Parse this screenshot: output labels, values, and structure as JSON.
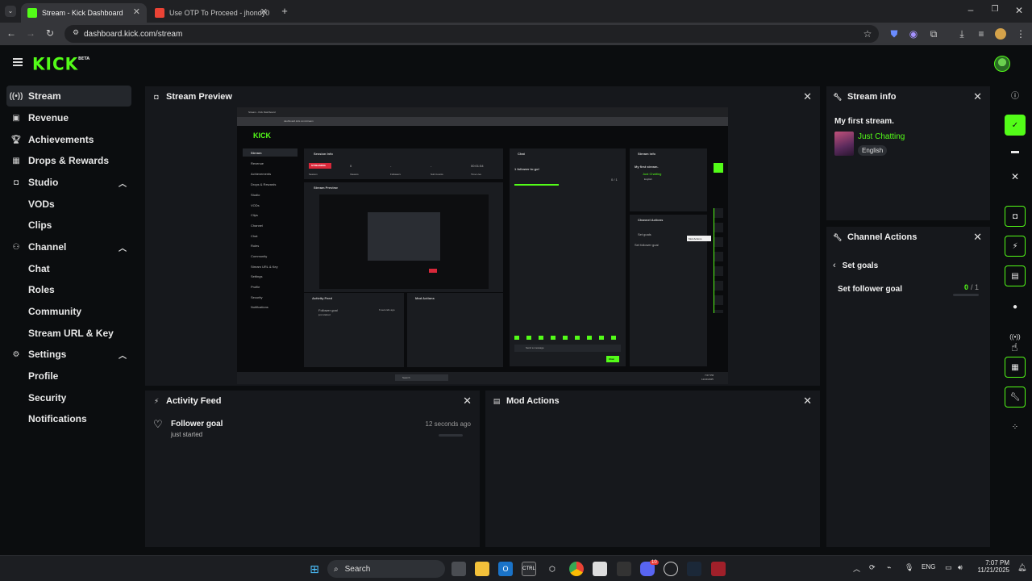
{
  "browser": {
    "tabs": [
      {
        "title": "Stream - Kick Dashboard",
        "active": true
      },
      {
        "title": "Use OTP To Proceed - jhondy0"
      }
    ],
    "url": "dashboard.kick.com/stream"
  },
  "header": {
    "logo": "KICK",
    "logo_badge": "BETA"
  },
  "sidebar": {
    "items": [
      {
        "label": "Stream",
        "icon": "broadcast-icon"
      },
      {
        "label": "Revenue",
        "icon": "wallet-icon"
      },
      {
        "label": "Achievements",
        "icon": "trophy-icon"
      },
      {
        "label": "Drops & Rewards",
        "icon": "gift-icon"
      },
      {
        "label": "Studio",
        "icon": "camera-icon"
      },
      {
        "label": "VODs"
      },
      {
        "label": "Clips"
      },
      {
        "label": "Channel",
        "icon": "users-icon"
      },
      {
        "label": "Chat"
      },
      {
        "label": "Roles"
      },
      {
        "label": "Community"
      },
      {
        "label": "Stream URL & Key"
      },
      {
        "label": "Settings",
        "icon": "gear-icon"
      },
      {
        "label": "Profile"
      },
      {
        "label": "Security"
      },
      {
        "label": "Notifications"
      }
    ]
  },
  "stream_preview": {
    "title": "Stream Preview",
    "mini": {
      "session_info": "Session Info",
      "streaming": "STREAMING",
      "session": "Session",
      "viewers": "Viewers",
      "followers": "Followers",
      "sub_counts": "Sub Counts",
      "time_live": "Time Live",
      "viewers_val": "0",
      "followers_val": "-",
      "subs_val": "-",
      "time_val": "00:01:54",
      "chat": "Chat",
      "follower_goal": "1 follower to go!",
      "goal_count": "0 / 1",
      "stream_info": "Stream info",
      "first_stream": "My first stream.",
      "just_chatting": "Just Chatting",
      "english": "English",
      "channel_actions": "Channel Actions",
      "set_goals": "Set goals",
      "set_follower_goal": "Set follower goal",
      "mod_actions_tip": "Mod Actions",
      "activity_feed": "Activity Feed",
      "follower_goal_item": "Follower goal",
      "just_started": "just started",
      "seconds_ago": "6 seconds ago",
      "mod_actions": "Mod Actions",
      "send_message": "Send a message",
      "chat_btn": "Chat",
      "search": "Search",
      "time": "7:07 PM",
      "date": "11/21/2025"
    }
  },
  "stream_info": {
    "title": "Stream info",
    "stream_title": "My first stream.",
    "category": "Just Chatting",
    "tag": "English"
  },
  "channel_actions": {
    "title": "Channel Actions",
    "back_label": "Set goals",
    "goal_label": "Set follower goal",
    "goal_current": "0",
    "goal_total": "/ 1",
    "goal_progress": 0
  },
  "activity_feed": {
    "title": "Activity Feed",
    "items": [
      {
        "title": "Follower goal",
        "subtitle": "just started",
        "time": "12 seconds ago"
      }
    ]
  },
  "mod_actions": {
    "title": "Mod Actions"
  },
  "taskbar": {
    "search": "Search",
    "lang": "ENG",
    "time": "7:07 PM",
    "date": "11/21/2025",
    "badge": "10"
  },
  "colors": {
    "accent": "#53fc18",
    "panel": "#16181c",
    "background": "#0b0d0f"
  }
}
